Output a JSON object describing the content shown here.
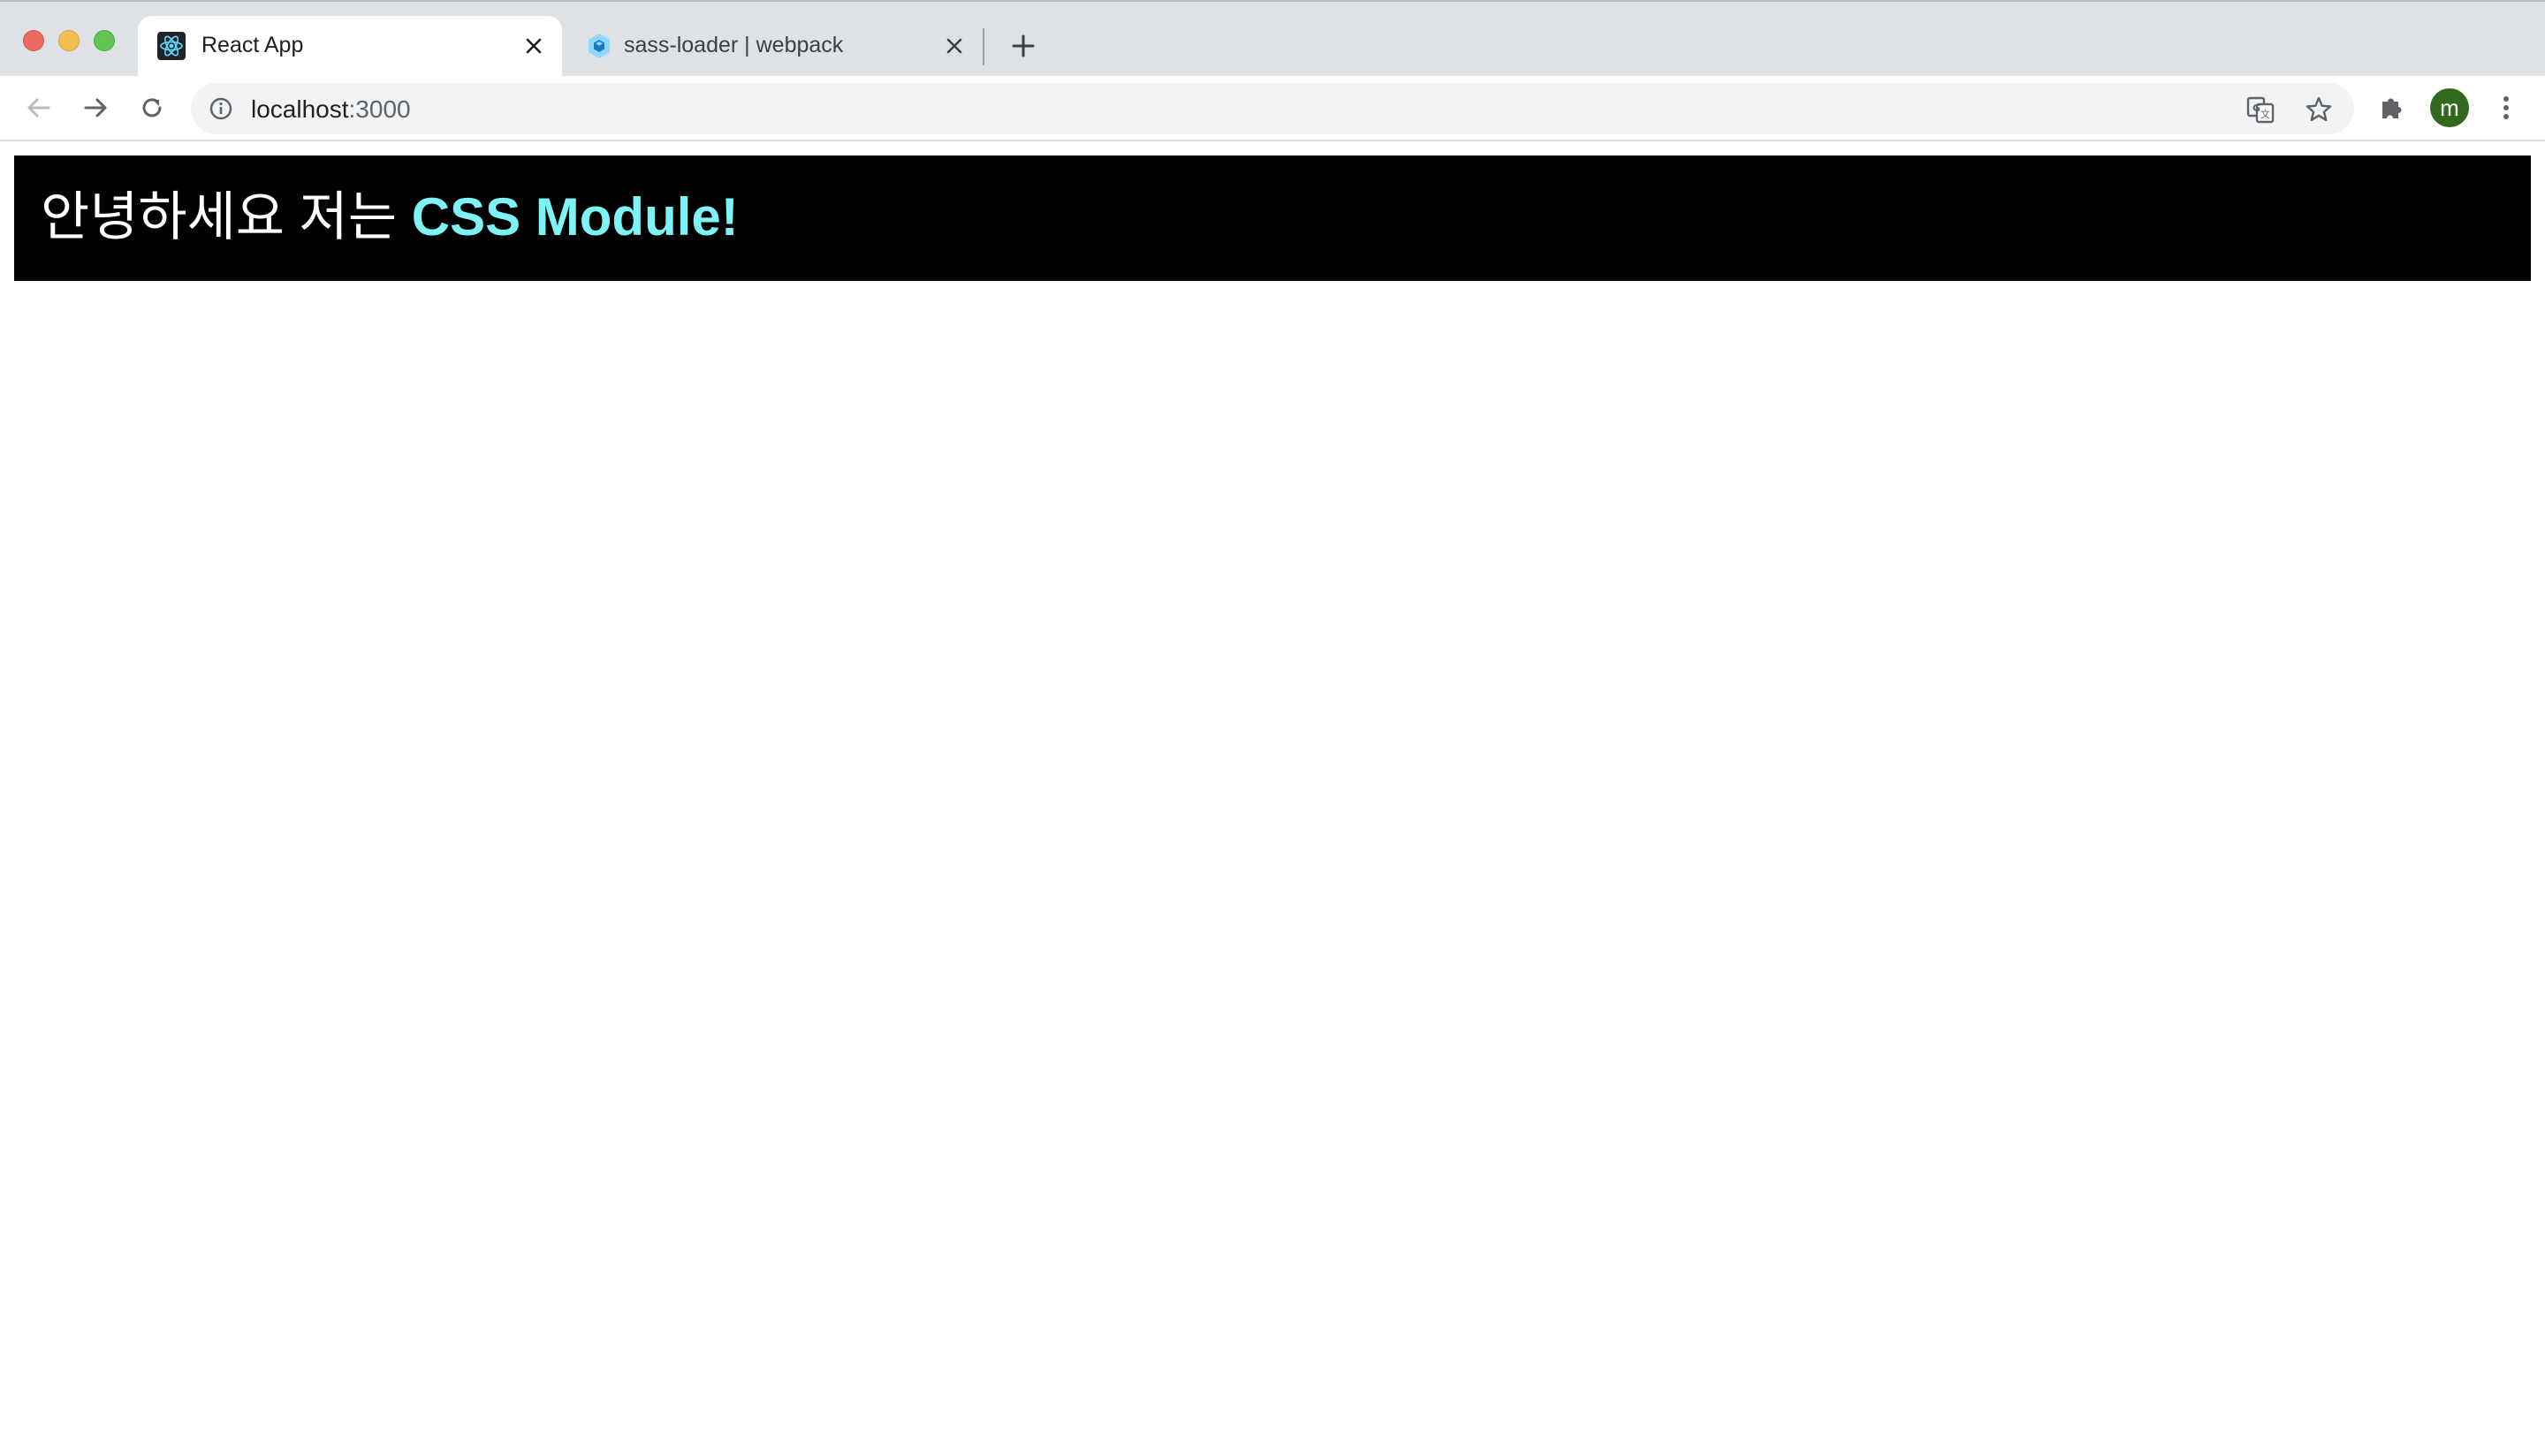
{
  "browser": {
    "tabs": [
      {
        "title": "React App",
        "active": true,
        "favicon": "react-logo-icon"
      },
      {
        "title": "sass-loader | webpack",
        "active": false,
        "favicon": "webpack-logo-icon"
      }
    ],
    "address": {
      "host": "localhost",
      "port": ":3000"
    },
    "profile_initial": "m",
    "colors": {
      "tabstrip": "#dee1e6",
      "omnibox": "#f1f3f4",
      "avatar": "#33691e"
    }
  },
  "page": {
    "heading_text": "안녕하세요 저는 ",
    "heading_highlight": "CSS Module!",
    "colors": {
      "background": "#000000",
      "text": "#ffffff",
      "highlight": "#7ef3f5"
    }
  }
}
